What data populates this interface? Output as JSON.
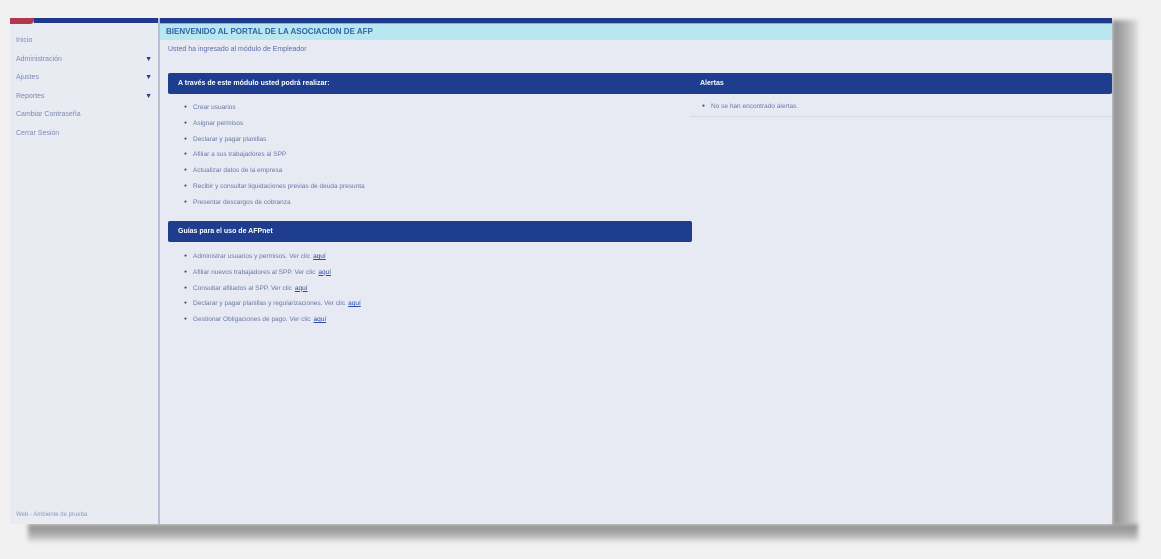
{
  "sidebar": {
    "items": [
      {
        "label": "Inicio",
        "has_arrow": false
      },
      {
        "label": "Administración",
        "has_arrow": true
      },
      {
        "label": "Ajustes",
        "has_arrow": true
      },
      {
        "label": "Reportes",
        "has_arrow": true
      },
      {
        "label": "Cambiar Contraseña",
        "has_arrow": false
      },
      {
        "label": "Cerrar Sesión",
        "has_arrow": false
      }
    ],
    "footer": "Web - Ambiente de prueba"
  },
  "header": {
    "banner": "BIENVENIDO AL PORTAL DE LA ASOCIACION DE AFP",
    "subtitle": "Usted ha ingresado al módulo de Empleador"
  },
  "actions_panel": {
    "title": "A través de este módulo usted podrá realizar:",
    "items": [
      "Crear usuarios",
      "Asignar permisos",
      "Declarar y pagar planillas",
      "Afiliar a sus trabajadores al SPP",
      "Actualizar datos de la empresa",
      "Recibir y consultar liquidaciones previas de deuda presunta",
      "Presentar descargos de cobranza"
    ]
  },
  "guides_panel": {
    "title": "Guías para el uso de AFPnet",
    "link_text": "aquí",
    "items": [
      "Administrar usuarios y permisos. Ver clic",
      "Afiliar nuevos trabajadores al SPP. Ver clic",
      "Consultar afiliados al SPP. Ver clic",
      "Declarar y pagar planillas y regularizaciones. Ver clic",
      "Gestionar Obligaciones de pago. Ver clic"
    ]
  },
  "alerts_panel": {
    "title": "Alertas",
    "message": "No se han encontrado alertas."
  },
  "colors": {
    "header_blue": "#1e3d8f",
    "banner_cyan": "#b8e7f0",
    "brand_red": "#b3364e"
  }
}
